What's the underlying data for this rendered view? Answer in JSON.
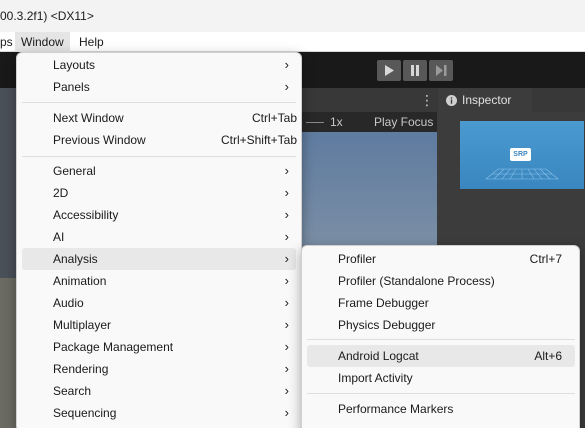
{
  "titlebar": {
    "text": "00.3.2f1) <DX11>"
  },
  "menubar": {
    "items": [
      "ps",
      "Window",
      "Help"
    ]
  },
  "toolbar": {
    "play_icon": "play-icon",
    "pause_icon": "pause-icon",
    "step_icon": "step-icon"
  },
  "scene": {
    "zoom": "1x",
    "focus_label": "Play Focus"
  },
  "inspector": {
    "tab_label": "Inspector",
    "badge": "SRP"
  },
  "menu": {
    "items": [
      {
        "label": "Layouts",
        "submenu": true
      },
      {
        "label": "Panels",
        "submenu": true
      },
      {
        "label": "Next Window",
        "shortcut": "Ctrl+Tab"
      },
      {
        "label": "Previous Window",
        "shortcut": "Ctrl+Shift+Tab"
      },
      {
        "label": "General",
        "submenu": true
      },
      {
        "label": "2D",
        "submenu": true
      },
      {
        "label": "Accessibility",
        "submenu": true
      },
      {
        "label": "AI",
        "submenu": true
      },
      {
        "label": "Analysis",
        "submenu": true,
        "highlighted": true
      },
      {
        "label": "Animation",
        "submenu": true
      },
      {
        "label": "Audio",
        "submenu": true
      },
      {
        "label": "Multiplayer",
        "submenu": true
      },
      {
        "label": "Package Management",
        "submenu": true
      },
      {
        "label": "Rendering",
        "submenu": true
      },
      {
        "label": "Search",
        "submenu": true
      },
      {
        "label": "Sequencing",
        "submenu": true
      }
    ],
    "chevron": "›"
  },
  "submenu": {
    "items": [
      {
        "label": "Profiler",
        "shortcut": "Ctrl+7"
      },
      {
        "label": "Profiler (Standalone Process)"
      },
      {
        "label": "Frame Debugger"
      },
      {
        "label": "Physics Debugger"
      },
      {
        "label": "Android Logcat",
        "shortcut": "Alt+6",
        "highlighted": true
      },
      {
        "label": "Import Activity"
      },
      {
        "label": "Performance Markers"
      }
    ]
  }
}
